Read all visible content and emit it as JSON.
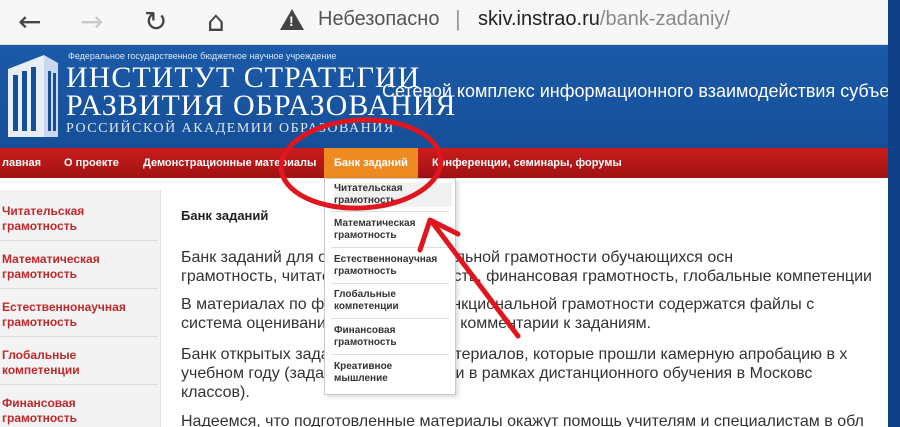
{
  "browser": {
    "back_icon": "←",
    "forward_icon": "→",
    "reload_icon": "↻",
    "home_icon": "⌂",
    "security_label": "Небезопасно",
    "url_separator": "|",
    "url_host": "skiv.instrao.ru",
    "url_path": "/bank-zadaniy/"
  },
  "header": {
    "org_line": "Федеральное государственное бюджетное научное учреждение",
    "title_line1": "ИНСТИТУТ СТРАТЕГИИ",
    "title_line2": "РАЗВИТИЯ ОБРАЗОВАНИЯ",
    "title_line3": "РОССИЙСКОЙ АКАДЕМИИ ОБРАЗОВАНИЯ",
    "tagline": "Сетевой комплекс информационного взаимодействия субъекто"
  },
  "nav": {
    "items": [
      "лавная",
      "О проекте",
      "Демонстрационные материалы",
      "Банк заданий",
      "Конференции, семинары, форумы"
    ]
  },
  "dropdown": {
    "items": [
      [
        "Читательская",
        "грамотность"
      ],
      [
        "Математическая",
        "грамотность"
      ],
      [
        "Естественнонаучная",
        "грамотность"
      ],
      [
        "Глобальные",
        "компетенции"
      ],
      [
        "Финансовая",
        "грамотность"
      ],
      [
        "Креативное",
        "мышление"
      ]
    ]
  },
  "sidebar": {
    "items": [
      [
        "Читательская",
        "грамотность"
      ],
      [
        "Математическая",
        "грамотность"
      ],
      [
        "Естественнонаучная",
        "грамотность"
      ],
      [
        "Глобальные",
        "компетенции"
      ],
      [
        "Финансовая",
        "грамотность"
      ]
    ]
  },
  "content": {
    "heading": "Банк заданий",
    "p1_line1": "Банк заданий для оценки функциональной грамотности обучающихся осн",
    "p1_line2": "грамотность, читательская грамотность, финансовая грамотность, глобальные компетенции",
    "p2_line1": "В материалах по формированию функциональной грамотности содержатся файлы с",
    "p2_line2": "система оценивания и методические комментарии к заданиям.",
    "p3_line1": "Банк открытых заданий включает материалов, которые прошли камерную апробацию в х",
    "p3_line2": "учебном году (задания для классов) и в рамках дистанционного обучения в Московс",
    "p3_line3": "классов).",
    "p4_line1": "Надеемся, что подготовленные материалы окажут помощь учителям и специалистам в обл"
  },
  "colors": {
    "header_blue": "#1b5aa8",
    "nav_red": "#b71818",
    "nav_active": "#ed8a21",
    "sidebar_link": "#c0282a",
    "annotation_red": "#e0161e"
  }
}
